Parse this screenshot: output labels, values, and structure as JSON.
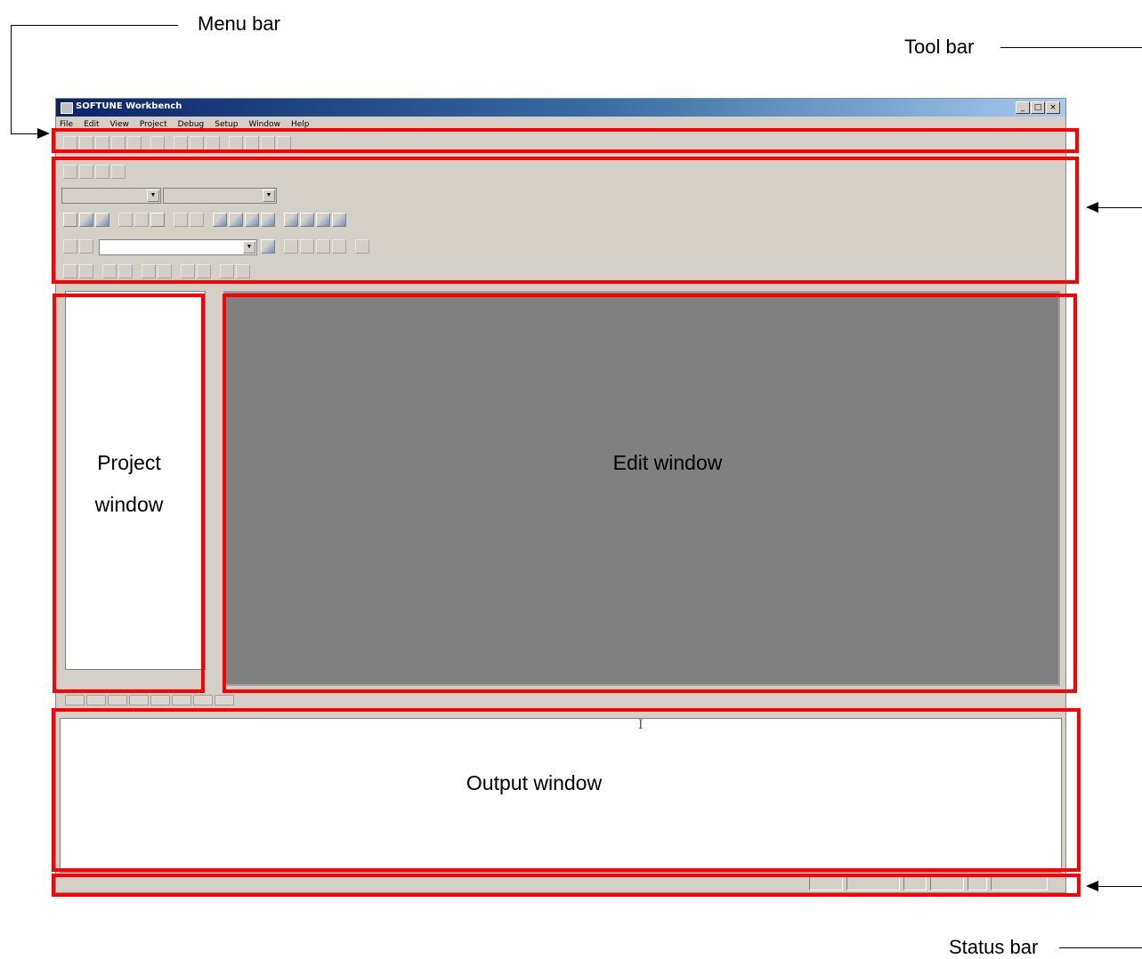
{
  "callouts": {
    "menu_bar": "Menu bar",
    "tool_bar": "Tool bar",
    "status_bar": "Status bar",
    "project_window_line1": "Project",
    "project_window_line2": "window",
    "edit_window": "Edit window",
    "output_window": "Output window"
  },
  "app": {
    "title": "SOFTUNE Workbench",
    "menu": [
      "File",
      "Edit",
      "View",
      "Project",
      "Debug",
      "Setup",
      "Window",
      "Help"
    ],
    "caption_buttons": [
      "_",
      "□",
      "×"
    ]
  },
  "colors": {
    "highlight": "#ff0000",
    "window_face": "#d4d0c8",
    "edit_area": "#808080",
    "titlebar_start": "#0a246a"
  }
}
